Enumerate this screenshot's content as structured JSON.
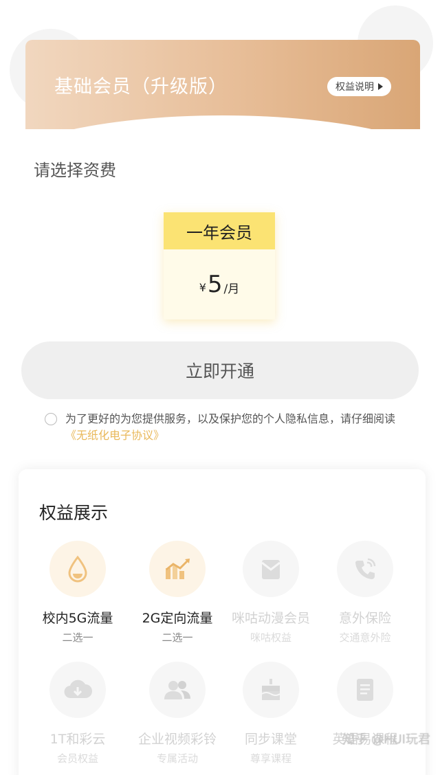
{
  "banner": {
    "title": "基础会员（升级版）",
    "rights_label": "权益说明"
  },
  "select_label": "请选择资费",
  "plan": {
    "name": "一年会员",
    "currency": "¥",
    "price": "5",
    "unit": "/月"
  },
  "open_button": "立即开通",
  "agreement": {
    "text": "为了更好的为您提供服务，以及保护您的个人隐私信息，请仔细阅读",
    "link": "《无纸化电子协议》"
  },
  "benefits": {
    "title": "权益展示",
    "items": [
      {
        "name": "校内5G流量",
        "sub": "二选一",
        "icon": "water-drop-icon"
      },
      {
        "name": "2G定向流量",
        "sub": "二选一",
        "icon": "trend-chart-icon"
      },
      {
        "name": "咪咕动漫会员",
        "sub": "咪咕权益",
        "icon": "envelope-icon"
      },
      {
        "name": "意外保险",
        "sub": "交通意外险",
        "icon": "phone-icon"
      },
      {
        "name": "1T和彩云",
        "sub": "会员权益",
        "icon": "cloud-download-icon"
      },
      {
        "name": "企业视频彩铃",
        "sub": "专属活动",
        "icon": "users-icon"
      },
      {
        "name": "同步课堂",
        "sub": "尊享课程",
        "icon": "cake-icon"
      },
      {
        "name": "英语易课程",
        "sub": "",
        "icon": "document-icon"
      }
    ]
  },
  "watermark": "知乎 @HUI玩君"
}
